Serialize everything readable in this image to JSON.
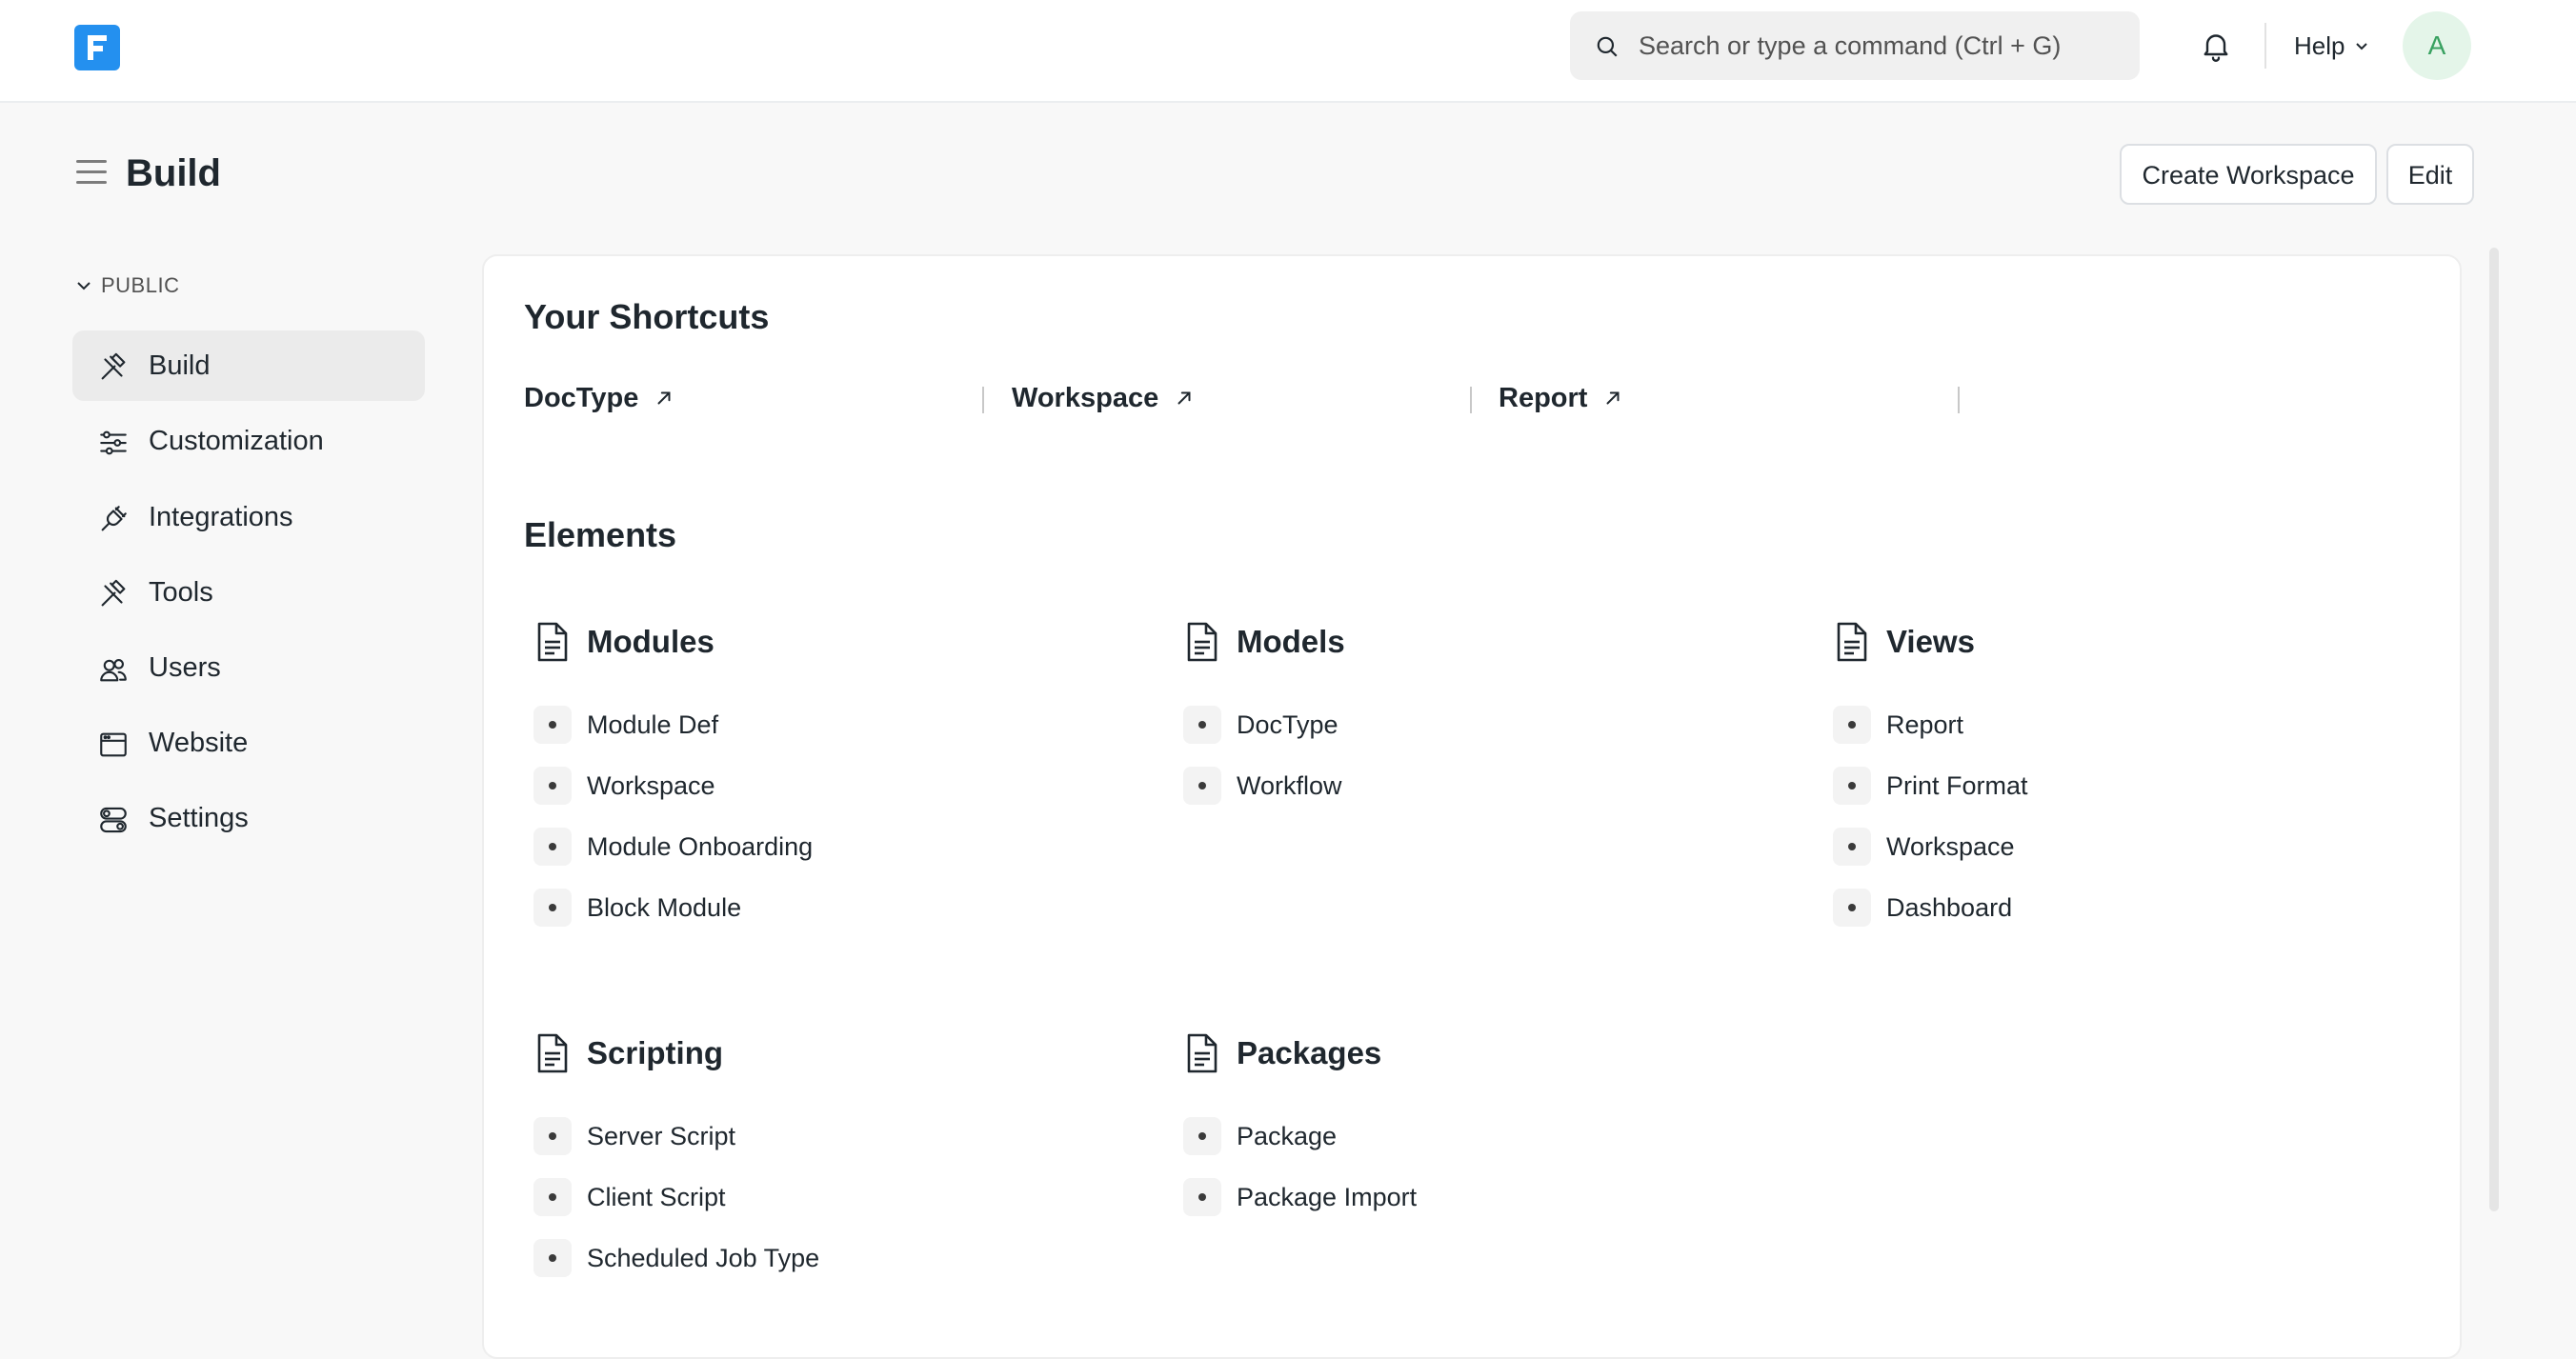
{
  "navbar": {
    "search_placeholder": "Search or type a command (Ctrl + G)",
    "help_label": "Help",
    "avatar_initial": "A"
  },
  "page": {
    "title": "Build",
    "create_workspace_label": "Create Workspace",
    "edit_label": "Edit"
  },
  "sidebar": {
    "section_label": "PUBLIC",
    "items": [
      {
        "label": "Build",
        "icon": "hammer-icon",
        "active": true
      },
      {
        "label": "Customization",
        "icon": "sliders-icon"
      },
      {
        "label": "Integrations",
        "icon": "plug-icon"
      },
      {
        "label": "Tools",
        "icon": "tools-icon"
      },
      {
        "label": "Users",
        "icon": "users-icon"
      },
      {
        "label": "Website",
        "icon": "browser-icon"
      },
      {
        "label": "Settings",
        "icon": "toggles-icon"
      }
    ]
  },
  "shortcuts": {
    "title": "Your Shortcuts",
    "items": [
      {
        "label": "DocType"
      },
      {
        "label": "Workspace"
      },
      {
        "label": "Report"
      }
    ]
  },
  "elements": {
    "title": "Elements",
    "groups": [
      {
        "title": "Modules",
        "links": [
          "Module Def",
          "Workspace",
          "Module Onboarding",
          "Block Module"
        ]
      },
      {
        "title": "Models",
        "links": [
          "DocType",
          "Workflow"
        ]
      },
      {
        "title": "Views",
        "links": [
          "Report",
          "Print Format",
          "Workspace",
          "Dashboard"
        ]
      },
      {
        "title": "Scripting",
        "links": [
          "Server Script",
          "Client Script",
          "Scheduled Job Type"
        ]
      },
      {
        "title": "Packages",
        "links": [
          "Package",
          "Package Import"
        ]
      }
    ]
  },
  "colors": {
    "brand": "#2490ef",
    "avatar_bg": "#e4f5e9",
    "avatar_text": "#38a160"
  }
}
